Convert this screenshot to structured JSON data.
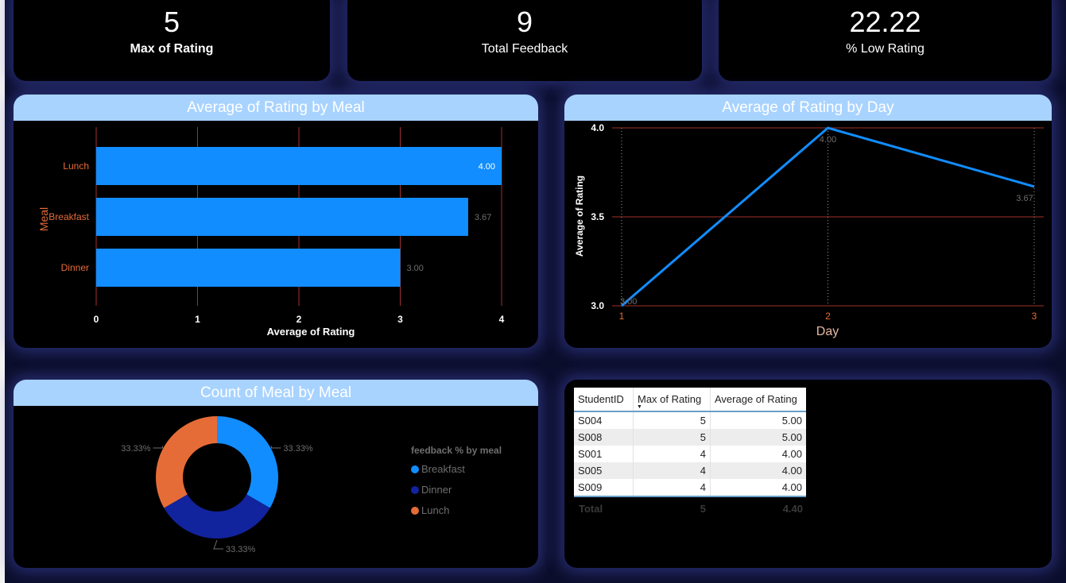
{
  "kpis": [
    {
      "value": "5",
      "label": "Max of Rating"
    },
    {
      "value": "9",
      "label": "Total Feedback"
    },
    {
      "value": "22.22",
      "label": "% Low Rating"
    }
  ],
  "colors": {
    "accent": "#118dff",
    "dark_blue": "#12239e",
    "orange": "#e66c37",
    "header": "#a8d3ff",
    "background": "#0b0e2b"
  },
  "meal_chart": {
    "title": "Average of Rating by Meal",
    "ylabel": "Meal",
    "xlabel": "Average of Rating",
    "ticks": [
      "0",
      "1",
      "2",
      "3",
      "4"
    ],
    "data_labels": [
      "4.00",
      "3.67",
      "3.00"
    ]
  },
  "day_chart": {
    "title": "Average of Rating by Day",
    "ylabel": "Average of Rating",
    "xlabel": "Day",
    "y_ticks": [
      "4.0",
      "3.5",
      "3.0"
    ],
    "x_ticks": [
      "1",
      "2",
      "3"
    ],
    "data_labels": [
      "3.00",
      "4.00",
      "3.67"
    ]
  },
  "donut_chart": {
    "title": "Count of Meal by Meal",
    "legend_title": "feedback % by meal",
    "legend": [
      {
        "label": "Breakfast",
        "color": "#118dff"
      },
      {
        "label": "Dinner",
        "color": "#12239e"
      },
      {
        "label": "Lunch",
        "color": "#e66c37"
      }
    ],
    "slice_labels": [
      "33.33%",
      "33.33%",
      "33.33%"
    ]
  },
  "table": {
    "headers": [
      "StudentID",
      "Max of Rating",
      "Average of Rating"
    ],
    "rows": [
      [
        "S004",
        "5",
        "5.00"
      ],
      [
        "S008",
        "5",
        "5.00"
      ],
      [
        "S001",
        "4",
        "4.00"
      ],
      [
        "S005",
        "4",
        "4.00"
      ],
      [
        "S009",
        "4",
        "4.00"
      ]
    ],
    "total": [
      "Total",
      "5",
      "4.40"
    ],
    "sort_icon": "sort-down-icon"
  },
  "chart_data": [
    {
      "type": "bar",
      "orientation": "horizontal",
      "title": "Average of Rating by Meal",
      "categories": [
        "Lunch",
        "Breakfast",
        "Dinner"
      ],
      "values": [
        4.0,
        3.67,
        3.0
      ],
      "xlabel": "Average of Rating",
      "ylabel": "Meal",
      "xlim": [
        0,
        4
      ],
      "grid": true
    },
    {
      "type": "line",
      "title": "Average of Rating by Day",
      "x": [
        1,
        2,
        3
      ],
      "values": [
        3.0,
        4.0,
        3.67
      ],
      "xlabel": "Day",
      "ylabel": "Average of Rating",
      "ylim": [
        3.0,
        4.0
      ],
      "grid": true
    },
    {
      "type": "pie",
      "title": "Count of Meal by Meal",
      "categories": [
        "Breakfast",
        "Dinner",
        "Lunch"
      ],
      "values": [
        33.33,
        33.33,
        33.33
      ],
      "legend": "right"
    }
  ]
}
